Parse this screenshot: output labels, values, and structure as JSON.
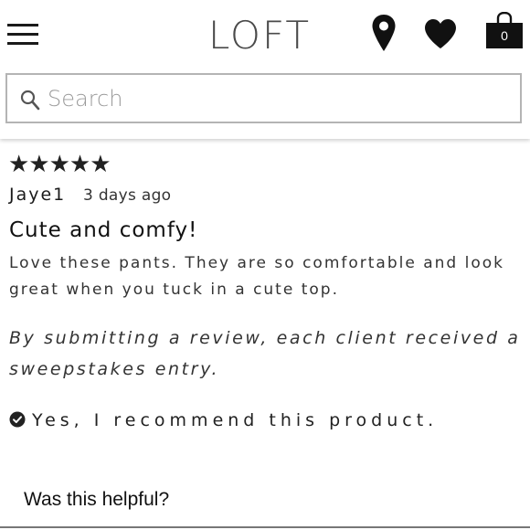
{
  "header": {
    "logo": "LOFT",
    "bag_count": "0",
    "icons": [
      "menu-icon",
      "location-pin-icon",
      "heart-icon",
      "shopping-bag-icon"
    ]
  },
  "search": {
    "placeholder": "Search",
    "icon": "search-icon"
  },
  "review": {
    "stars": "★★★★★",
    "rating": 5,
    "author": "Jaye1",
    "date": "3 days ago",
    "title": "Cute and comfy!",
    "body": "Love these pants. They are so comfortable and look great when you tuck in a cute top.",
    "disclaimer": "By submitting a review, each client received a sweepstakes entry.",
    "recommend": "Yes, I recommend this product.",
    "recommend_icon": "check-circle-icon"
  },
  "footer": {
    "helpful": "Was this helpful?"
  }
}
